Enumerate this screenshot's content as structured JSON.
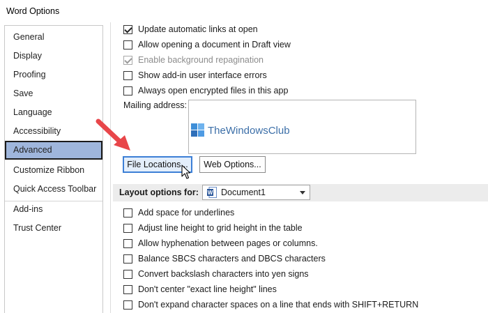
{
  "window": {
    "title": "Word Options"
  },
  "sidebar": {
    "items": [
      {
        "label": "General"
      },
      {
        "label": "Display"
      },
      {
        "label": "Proofing"
      },
      {
        "label": "Save"
      },
      {
        "label": "Language"
      },
      {
        "label": "Accessibility"
      },
      {
        "label": "Advanced",
        "selected": true
      },
      {
        "label": "Customize Ribbon"
      },
      {
        "label": "Quick Access Toolbar"
      },
      {
        "label": "Add-ins"
      },
      {
        "label": "Trust Center"
      }
    ]
  },
  "general_options": [
    {
      "label": "Update automatic links at open",
      "checked": true,
      "enabled": true
    },
    {
      "label": "Allow opening a document in Draft view",
      "checked": false,
      "enabled": true
    },
    {
      "label": "Enable background repagination",
      "checked": true,
      "enabled": false
    },
    {
      "label": "Show add-in user interface errors",
      "checked": false,
      "enabled": true
    },
    {
      "label": "Always open encrypted files in this app",
      "checked": false,
      "enabled": true
    }
  ],
  "mailing": {
    "label": "Mailing address:",
    "value": ""
  },
  "watermark": {
    "text": "TheWindowsClub"
  },
  "buttons": {
    "file_locations": "File Locations...",
    "web_options": "Web Options..."
  },
  "layout_section": {
    "title": "Layout options for:",
    "document": "Document1"
  },
  "layout_options": [
    {
      "label": "Add space for underlines",
      "checked": false
    },
    {
      "label": "Adjust line height to grid height in the table",
      "checked": false
    },
    {
      "label": "Allow hyphenation between pages or columns.",
      "checked": false
    },
    {
      "label": "Balance SBCS characters and DBCS characters",
      "checked": false
    },
    {
      "label": "Convert backslash characters into yen signs",
      "checked": false
    },
    {
      "label": "Don't center \"exact line height\" lines",
      "checked": false
    },
    {
      "label": "Don't expand character spaces on a line that ends with SHIFT+RETURN",
      "checked": false
    }
  ],
  "colors": {
    "accent_selected": "#9fb6dc",
    "annotation_arrow": "#e8464a",
    "focus_border": "#3c7fd6"
  }
}
